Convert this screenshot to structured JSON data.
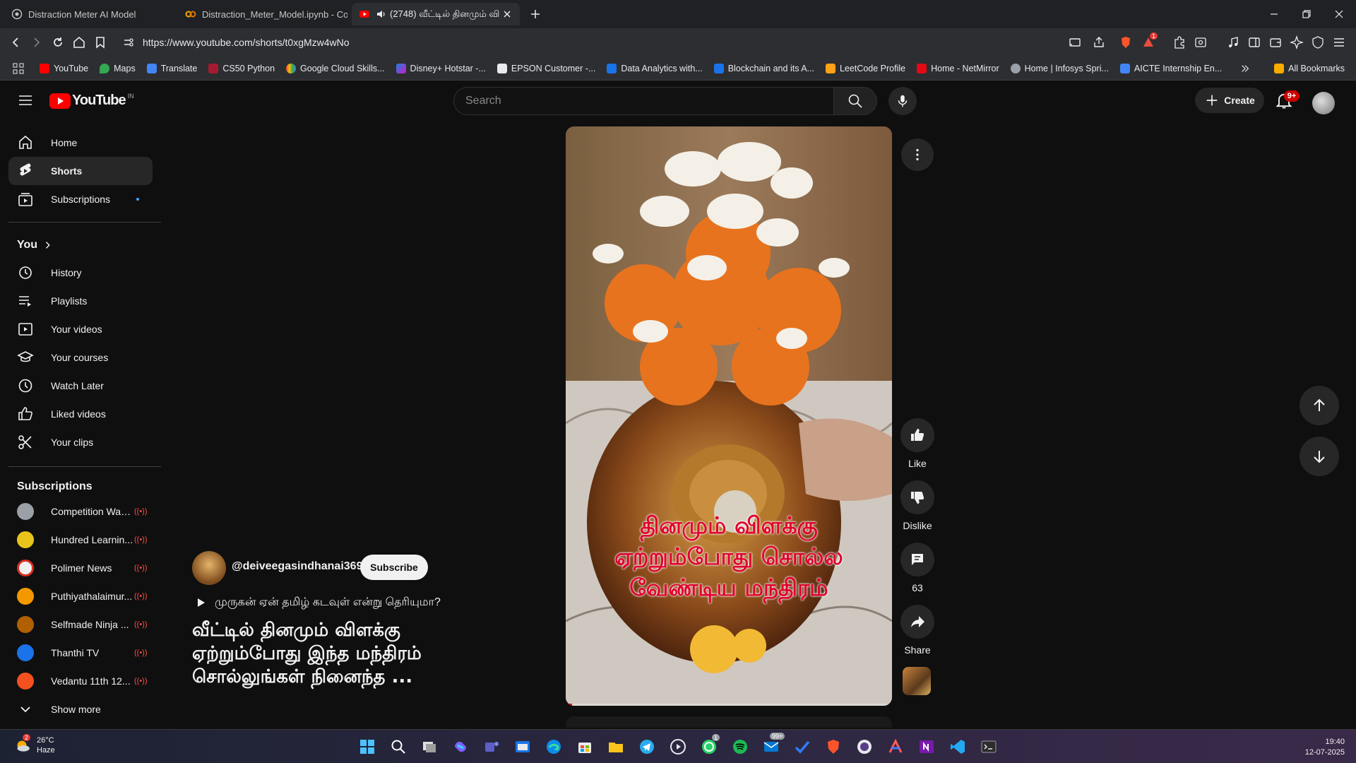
{
  "browser": {
    "tabs": [
      {
        "title": "Distraction Meter AI Model"
      },
      {
        "title": "Distraction_Meter_Model.ipynb - Col"
      },
      {
        "title": "(2748) வீட்டில் தினமும் வி"
      }
    ],
    "url": "https://www.youtube.com/shorts/t0xgMzw4wNo",
    "bookmarks": [
      "YouTube",
      "Maps",
      "Translate",
      "CS50 Python",
      "Google Cloud Skills...",
      "Disney+ Hotstar -...",
      "EPSON Customer -...",
      "Data Analytics with...",
      "Blockchain and its A...",
      "LeetCode Profile",
      "Home - NetMirror",
      "Home | Infosys Spri...",
      "AICTE Internship En..."
    ],
    "all_bookmarks": "All Bookmarks",
    "shield_badge": "1"
  },
  "header": {
    "logo_text": "YouTube",
    "region": "IN",
    "search_placeholder": "Search",
    "create_label": "Create",
    "notif_badge": "9+"
  },
  "sidebar": {
    "main": [
      {
        "label": "Home",
        "icon": "home-icon"
      },
      {
        "label": "Shorts",
        "icon": "shorts-icon"
      },
      {
        "label": "Subscriptions",
        "icon": "subscriptions-icon"
      }
    ],
    "you_heading": "You",
    "you": [
      {
        "label": "History",
        "icon": "history-icon"
      },
      {
        "label": "Playlists",
        "icon": "playlists-icon"
      },
      {
        "label": "Your videos",
        "icon": "your-videos-icon"
      },
      {
        "label": "Your courses",
        "icon": "courses-icon"
      },
      {
        "label": "Watch Later",
        "icon": "clock-icon"
      },
      {
        "label": "Liked videos",
        "icon": "like-icon"
      },
      {
        "label": "Your clips",
        "icon": "scissors-icon"
      }
    ],
    "subs_heading": "Subscriptions",
    "subscriptions": [
      {
        "label": "Competition Wall...",
        "color": "#9aa0a6"
      },
      {
        "label": "Hundred Learnin...",
        "color": "#e8c41b"
      },
      {
        "label": "Polimer News",
        "color": "#d93025"
      },
      {
        "label": "Puthiyathalaimur...",
        "color": "#f29900"
      },
      {
        "label": "Selfmade Ninja ...",
        "color": "#b06000"
      },
      {
        "label": "Thanthi TV",
        "color": "#1a73e8"
      },
      {
        "label": "Vedantu 11th 12...",
        "color": "#f4511e"
      }
    ],
    "show_more": "Show more"
  },
  "short": {
    "caption_lines": [
      "தினமும் விளக்கு",
      "ஏற்றும்போது சொல்ல",
      "வேண்டிய மந்திரம்"
    ],
    "channel": "@deiveegasindhanai369",
    "subscribe_label": "Subscribe",
    "music": "முருகன் ஏன் தமிழ் கடவுள் என்று தெரியுமா?",
    "title": "வீட்டில் தினமும் விளக்கு ஏற்றும்போது இந்த மந்திரம் சொல்லுங்கள் நினைந்த ...",
    "like_label": "Like",
    "dislike_label": "Dislike",
    "comments_count": "63",
    "share_label": "Share"
  },
  "taskbar": {
    "weather_temp": "26°C",
    "weather_desc": "Haze",
    "weather_badge": "2",
    "whatsapp_badge": "1",
    "mail_badge": "99+",
    "time": "19:40",
    "date": "12-07-2025"
  }
}
